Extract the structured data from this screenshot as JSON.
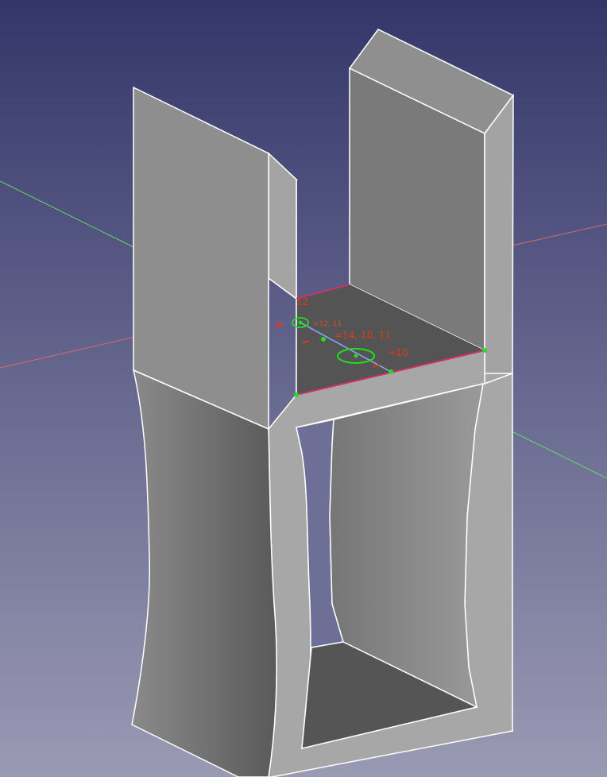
{
  "viewport": {
    "background_top": "#34366a",
    "background_bottom": "#9a9ab4"
  },
  "colors": {
    "axis_x": "#d86a6a",
    "axis_y": "#5ee05e",
    "face_light": "#9c9c9c",
    "face_mid": "#7a7a7a",
    "face_dark": "#555555",
    "edge": "#ffffff",
    "sketch_edge": "#d0306c",
    "constraint": "#e03a1a",
    "point": "#22dd22"
  },
  "constraints": {
    "label_1": "12",
    "label_2": "=14, 10, 11",
    "label_3": "=10",
    "label_4": "=12, 11"
  }
}
